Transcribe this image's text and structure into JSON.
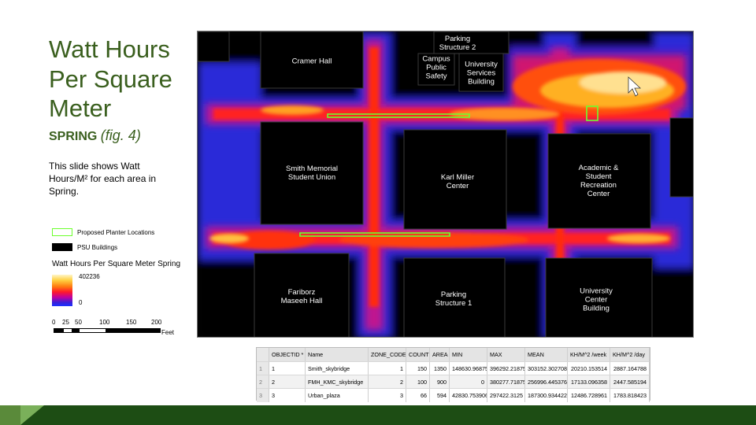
{
  "slide": {
    "title": "Watt Hours Per Square Meter",
    "season": "SPRING",
    "fig": "(fig. 4)",
    "description": "This slide shows Watt Hours/M² for each area in Spring."
  },
  "legend": {
    "planter_label": "Proposed Planter Locations",
    "buildings_label": "PSU Buildings",
    "ramp_title": "Watt Hours Per Square Meter Spring",
    "ramp_max": "402236",
    "ramp_min": "0",
    "scale_ticks": [
      "0",
      "25",
      "50",
      "100",
      "150",
      "200"
    ],
    "scale_unit": "Feet"
  },
  "map": {
    "buildings": {
      "cramer": "Cramer Hall",
      "parking2": "Parking\nStructure 2",
      "campus_safety": "Campus\nPublic\nSafety",
      "usb": "University\nServices\nBuilding",
      "smith": "Smith Memorial\nStudent Union",
      "kmc": "Karl Miller\nCenter",
      "asrc": "Academic &\nStudent\nRecreation\nCenter",
      "fariborz": "Fariborz\nMaseeh Hall",
      "parking1": "Parking\nStructure 1",
      "ucb": "University\nCenter\nBuilding"
    }
  },
  "table": {
    "headers": [
      "OBJECTID *",
      "Name",
      "ZONE_CODE",
      "COUNT",
      "AREA",
      "MIN",
      "MAX",
      "MEAN",
      "KH/M^2 /week",
      "KH/M^2 /day"
    ],
    "rows": [
      {
        "num": "1",
        "cells": [
          "1",
          "Smith_skybridge",
          "1",
          "150",
          "1350",
          "148630.96875",
          "396292.21875",
          "303152.302708",
          "20210.153514",
          "2887.164788"
        ]
      },
      {
        "num": "2",
        "cells": [
          "2",
          "FMH_KMC_skybridge",
          "2",
          "100",
          "900",
          "0",
          "380277.71875",
          "256996.445376",
          "17133.096358",
          "2447.585194"
        ]
      },
      {
        "num": "3",
        "cells": [
          "3",
          "Urban_plaza",
          "3",
          "66",
          "594",
          "42830.753906",
          "297422.3125",
          "187300.934422",
          "12486.728961",
          "1783.818423"
        ]
      }
    ]
  },
  "colors": {
    "title_green": "#3a5f1e",
    "footer_dark": "#1d4d14",
    "footer_light": "#7ab05a",
    "planter_green": "#6dff2e"
  }
}
